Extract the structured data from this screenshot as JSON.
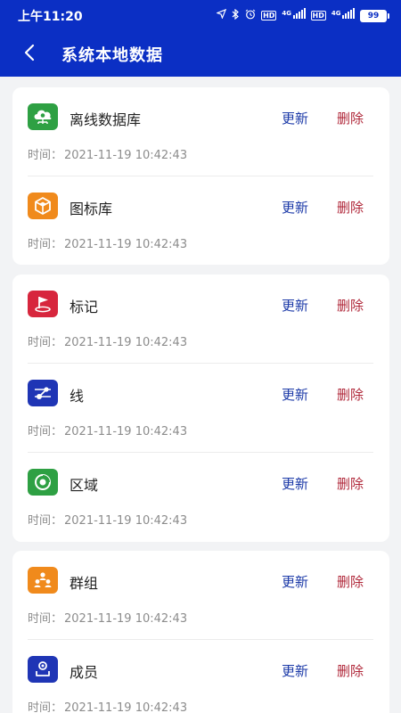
{
  "status_bar": {
    "time": "上午11:20",
    "network_badges": [
      "HD",
      "4G",
      "HD",
      "4G"
    ],
    "battery": "99"
  },
  "nav": {
    "title": "系统本地数据"
  },
  "time_label": "时间：",
  "colors": {
    "header_bg": "#0b2fc4",
    "update_text": "#1c3aa8",
    "delete_text": "#b0283a"
  },
  "groups": [
    {
      "items": [
        {
          "name": "离线数据库",
          "icon": "cloud-database-icon",
          "icon_color": "#2ea043",
          "update_label": "更新",
          "delete_label": "删除",
          "time": "2021-11-19 10:42:43"
        },
        {
          "name": "图标库",
          "icon": "cube-box-icon",
          "icon_color": "#f08a1c",
          "update_label": "更新",
          "delete_label": "删除",
          "time": "2021-11-19 10:42:43"
        }
      ]
    },
    {
      "items": [
        {
          "name": "标记",
          "icon": "flag-marker-icon",
          "icon_color": "#d7263d",
          "update_label": "更新",
          "delete_label": "删除",
          "time": "2021-11-19 10:42:43"
        },
        {
          "name": "线",
          "icon": "line-route-icon",
          "icon_color": "#1f35b5",
          "update_label": "更新",
          "delete_label": "删除",
          "time": "2021-11-19 10:42:43"
        },
        {
          "name": "区域",
          "icon": "area-pie-icon",
          "icon_color": "#2ea043",
          "update_label": "更新",
          "delete_label": "删除",
          "time": "2021-11-19 10:42:43"
        }
      ]
    },
    {
      "items": [
        {
          "name": "群组",
          "icon": "group-people-icon",
          "icon_color": "#f08a1c",
          "update_label": "更新",
          "delete_label": "删除",
          "time": "2021-11-19 10:42:43"
        },
        {
          "name": "成员",
          "icon": "member-person-icon",
          "icon_color": "#1f35b5",
          "update_label": "更新",
          "delete_label": "删除",
          "time": "2021-11-19 10:42:43"
        }
      ]
    }
  ]
}
